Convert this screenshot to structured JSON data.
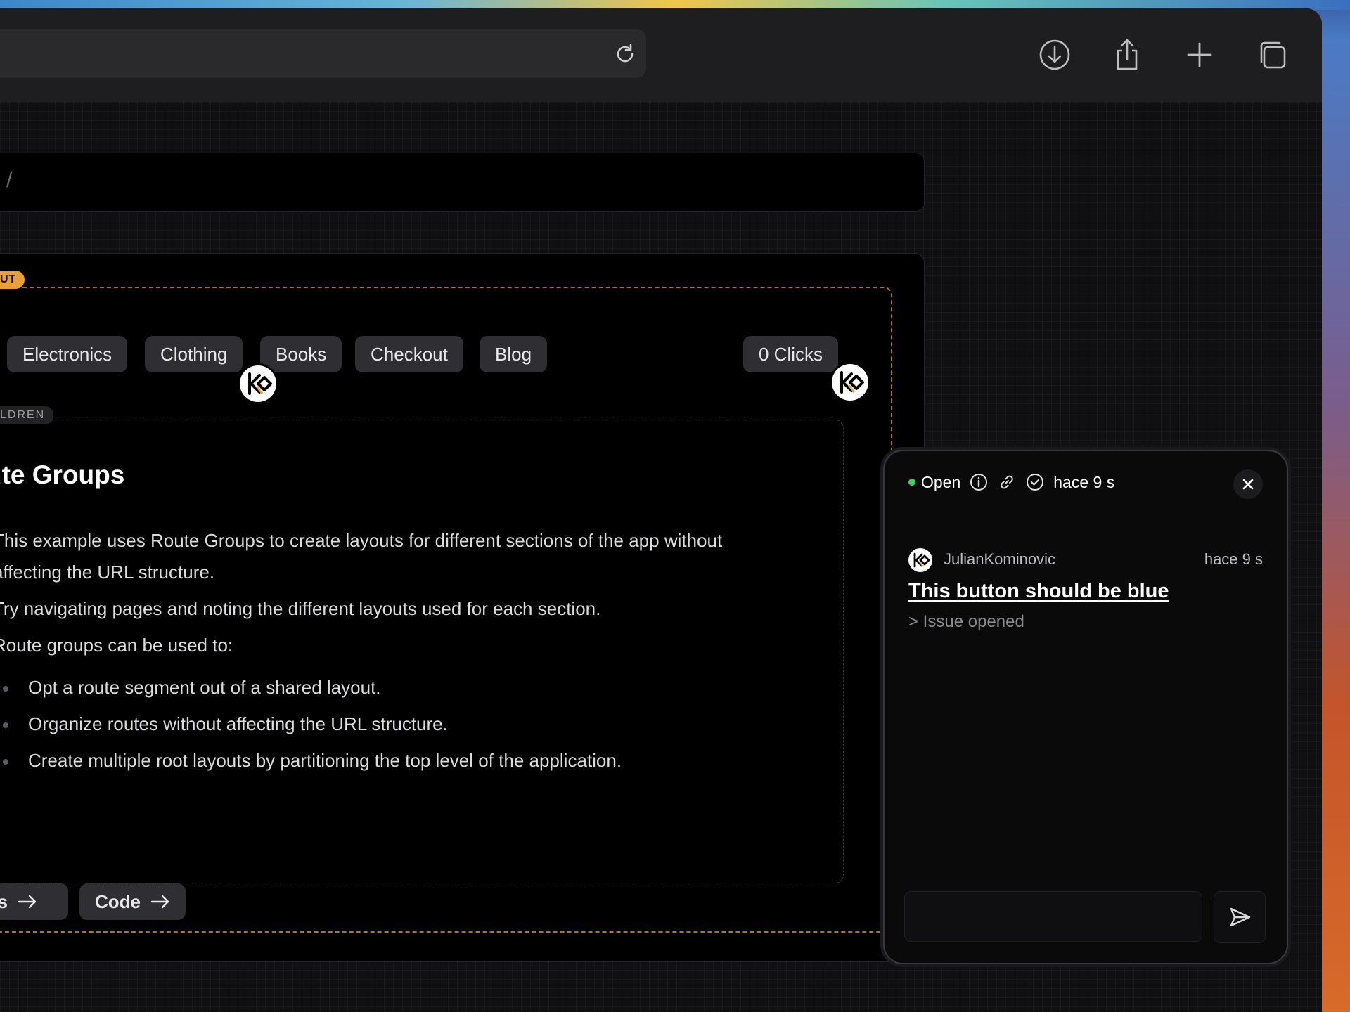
{
  "breadcrumb": {
    "separator": "/"
  },
  "layout_badge": "UT",
  "children_badge": "LDREN",
  "nav": {
    "items": [
      "Electronics",
      "Clothing",
      "Books",
      "Checkout",
      "Blog"
    ],
    "clicks_label": "0 Clicks"
  },
  "page": {
    "title": "ute Groups",
    "paragraphs": [
      "This example uses Route Groups to create layouts for different sections of the app without",
      "affecting the URL structure.",
      "Try navigating pages and noting the different layouts used for each section.",
      "Route groups can be used to:"
    ],
    "bullets": [
      "Opt a route segment out of a shared layout.",
      "Organize routes without affecting the URL structure.",
      "Create multiple root layouts by partitioning the top level of the application."
    ],
    "links": [
      {
        "label": "cs"
      },
      {
        "label": "Code"
      }
    ]
  },
  "comment": {
    "status": "Open",
    "status_color": "#3ecf5e",
    "header_time": "hace 9 s",
    "author": "JulianKominovic",
    "time": "hace 9 s",
    "title": "This button should be blue",
    "subtitle": "> Issue opened",
    "reply_placeholder": ""
  },
  "colors": {
    "layout_outline": "#b0732a",
    "layout_badge": "#e8a03a",
    "pill_bg": "#2f2f33"
  }
}
